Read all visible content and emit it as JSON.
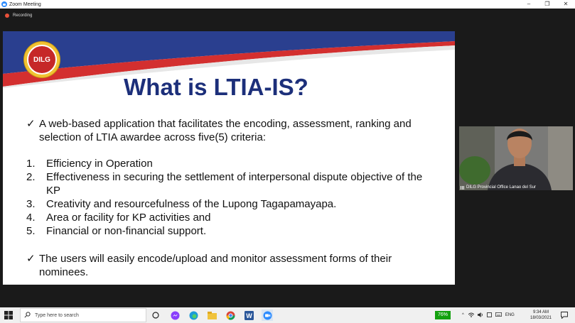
{
  "window": {
    "title": "Zoom Meeting",
    "recording_label": "Recording",
    "controls": [
      "–",
      "❐",
      "✕"
    ]
  },
  "slide": {
    "logo_text": "DILG",
    "title": "What is LTIA-IS?",
    "intro_bullet": "A web-based application that facilitates the encoding, assessment, ranking and selection of LTIA awardee across five(5) criteria:",
    "criteria": [
      {
        "num": "1.",
        "text": "Efficiency in Operation"
      },
      {
        "num": "2.",
        "text": "Effectiveness in securing the settlement of interpersonal dispute objective of the KP"
      },
      {
        "num": "3.",
        "text": "Creativity and resourcefulness of the Lupong Tagapamayapa."
      },
      {
        "num": "4.",
        "text": "Area or facility for KP activities and"
      },
      {
        "num": "5.",
        "text": "Financial or non-financial support."
      }
    ],
    "closing_bullet": "The users will easily encode/upload and monitor assessment forms of their nominees.",
    "check_glyph": "✓",
    "colors": {
      "title": "#1c2f7a",
      "banner_blue": "#2a3f8f",
      "banner_red": "#d32f2f"
    }
  },
  "video": {
    "participant_name": "DILG Provincial Office Lanao del Sur"
  },
  "taskbar": {
    "search_placeholder": "Type here to search",
    "battery": "76%",
    "language": "ENG",
    "time": "9:34 AM",
    "date": "18/03/2021",
    "pinned_apps": [
      "task-view-icon",
      "messenger-icon",
      "edge-icon",
      "file-explorer-icon",
      "chrome-icon",
      "word-icon",
      "zoom-icon"
    ]
  }
}
